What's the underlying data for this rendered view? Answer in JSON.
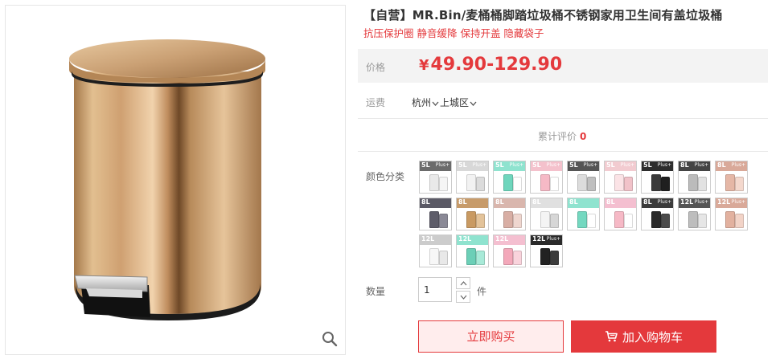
{
  "product": {
    "title": "【自营】MR.Bin/麦桶桶脚踏垃圾桶不锈钢家用卫生间有盖垃圾桶",
    "subtitle": "抗压保护圈 静音缓降 保持开盖 隐藏袋子"
  },
  "price": {
    "label": "价格",
    "currency": "¥",
    "value": "49.90-129.90",
    "color": "#e4393c"
  },
  "shipping": {
    "label": "运费",
    "city": "杭州",
    "district": "上城区"
  },
  "reviews": {
    "label": "累计评价",
    "count": "0"
  },
  "colors": {
    "label": "颜色分类",
    "swatches": [
      {
        "size": "5L",
        "plus": "Plus+",
        "head": "#6b6b6b",
        "can1": "#e9e9e9",
        "can2": "#f5f5f5"
      },
      {
        "size": "5L",
        "plus": "Plus+",
        "head": "#d8d8d8",
        "can1": "#f2f2f2",
        "can2": "#dcdcdc"
      },
      {
        "size": "5L",
        "plus": "Plus+",
        "head": "#8fe3cf",
        "can1": "#6fd6bd",
        "can2": "#ffffff"
      },
      {
        "size": "5L",
        "plus": "Plus+",
        "head": "#f4c1cc",
        "can1": "#f6b9c6",
        "can2": "#ffffff"
      },
      {
        "size": "5L",
        "plus": "Plus+",
        "head": "#555555",
        "can1": "#dcdcdc",
        "can2": "#bfbfbf"
      },
      {
        "size": "5L",
        "plus": "Plus+",
        "head": "#f2cbd0",
        "can1": "#fbe3e6",
        "can2": "#f1c2c9"
      },
      {
        "size": "5L",
        "plus": "Plus+",
        "head": "#2d2d2d",
        "can1": "#3a3a3a",
        "can2": "#1f1f1f"
      },
      {
        "size": "8L",
        "plus": "Plus+",
        "head": "#444444",
        "can1": "#bbbbbb",
        "can2": "#e2e2e2"
      },
      {
        "size": "8L",
        "plus": "Plus+",
        "head": "#d9a999",
        "can1": "#e5b7a6",
        "can2": "#f4d8cd"
      },
      {
        "size": "8L",
        "plus": "",
        "head": "#5b5a66",
        "can1": "#5d5c69",
        "can2": "#8a8996"
      },
      {
        "size": "8L",
        "plus": "",
        "head": "#c79b6a",
        "can1": "#c99a62",
        "can2": "#e3c39a"
      },
      {
        "size": "8L",
        "plus": "",
        "head": "#d9b6ad",
        "can1": "#d8aea4",
        "can2": "#efd6cf"
      },
      {
        "size": "8L",
        "plus": "",
        "head": "#e0e0e0",
        "can1": "#f4f4f4",
        "can2": "#d6d6d6"
      },
      {
        "size": "8L",
        "plus": "",
        "head": "#8fe3cf",
        "can1": "#74d8c0",
        "can2": "#ffffff"
      },
      {
        "size": "8L",
        "plus": "",
        "head": "#f4bfd0",
        "can1": "#f6b9c6",
        "can2": "#ffffff"
      },
      {
        "size": "8L",
        "plus": "Plus+",
        "head": "#3b3b3b",
        "can1": "#2a2a2a",
        "can2": "#4b4b4b"
      },
      {
        "size": "12L",
        "plus": "Plus+",
        "head": "#555555",
        "can1": "#bdbdbd",
        "can2": "#e6e6e6"
      },
      {
        "size": "12L",
        "plus": "Plus+",
        "head": "#d9a999",
        "can1": "#e2b19f",
        "can2": "#f2d3c7"
      },
      {
        "size": "12L",
        "plus": "",
        "head": "#cccccc",
        "can1": "#f7f7f7",
        "can2": "#e8e8e8"
      },
      {
        "size": "12L",
        "plus": "",
        "head": "#8fe3cf",
        "can1": "#6ccfb7",
        "can2": "#a8ead8"
      },
      {
        "size": "12L",
        "plus": "",
        "head": "#f4bfd0",
        "can1": "#f3a8ba",
        "can2": "#f9d3dc"
      },
      {
        "size": "12L",
        "plus": "Plus+",
        "head": "#2a2a2a",
        "can1": "#222222",
        "can2": "#3c3c3c"
      }
    ]
  },
  "quantity": {
    "label": "数量",
    "value": "1",
    "unit": "件"
  },
  "actions": {
    "buy_now": "立即购买",
    "add_to_cart": "加入购物车"
  }
}
